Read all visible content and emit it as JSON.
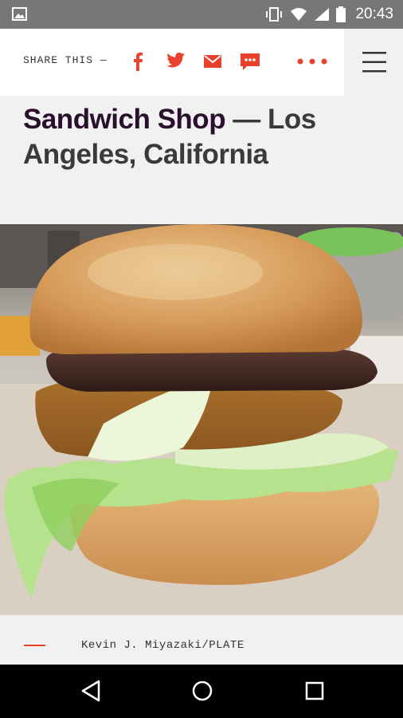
{
  "status_bar": {
    "time": "20:43",
    "icons": [
      "gallery-icon",
      "vibrate-icon",
      "wifi-icon",
      "cell-signal-icon",
      "battery-icon"
    ]
  },
  "share_bar": {
    "label": "SHARE THIS —",
    "actions": [
      "facebook-icon",
      "twitter-icon",
      "email-icon",
      "sms-icon",
      "more-icon"
    ],
    "accent_color": "#e8412c",
    "menu_icon": "hamburger-icon"
  },
  "article": {
    "title_strong": "Sandwich Shop",
    "title_rest": " — Los Angeles, California",
    "image_alt": "cheeseburger-photo",
    "credit": "Kevin J. Miyazaki/PLATE"
  },
  "nav_bar": {
    "buttons": [
      "back-icon",
      "home-icon",
      "recents-icon"
    ]
  }
}
